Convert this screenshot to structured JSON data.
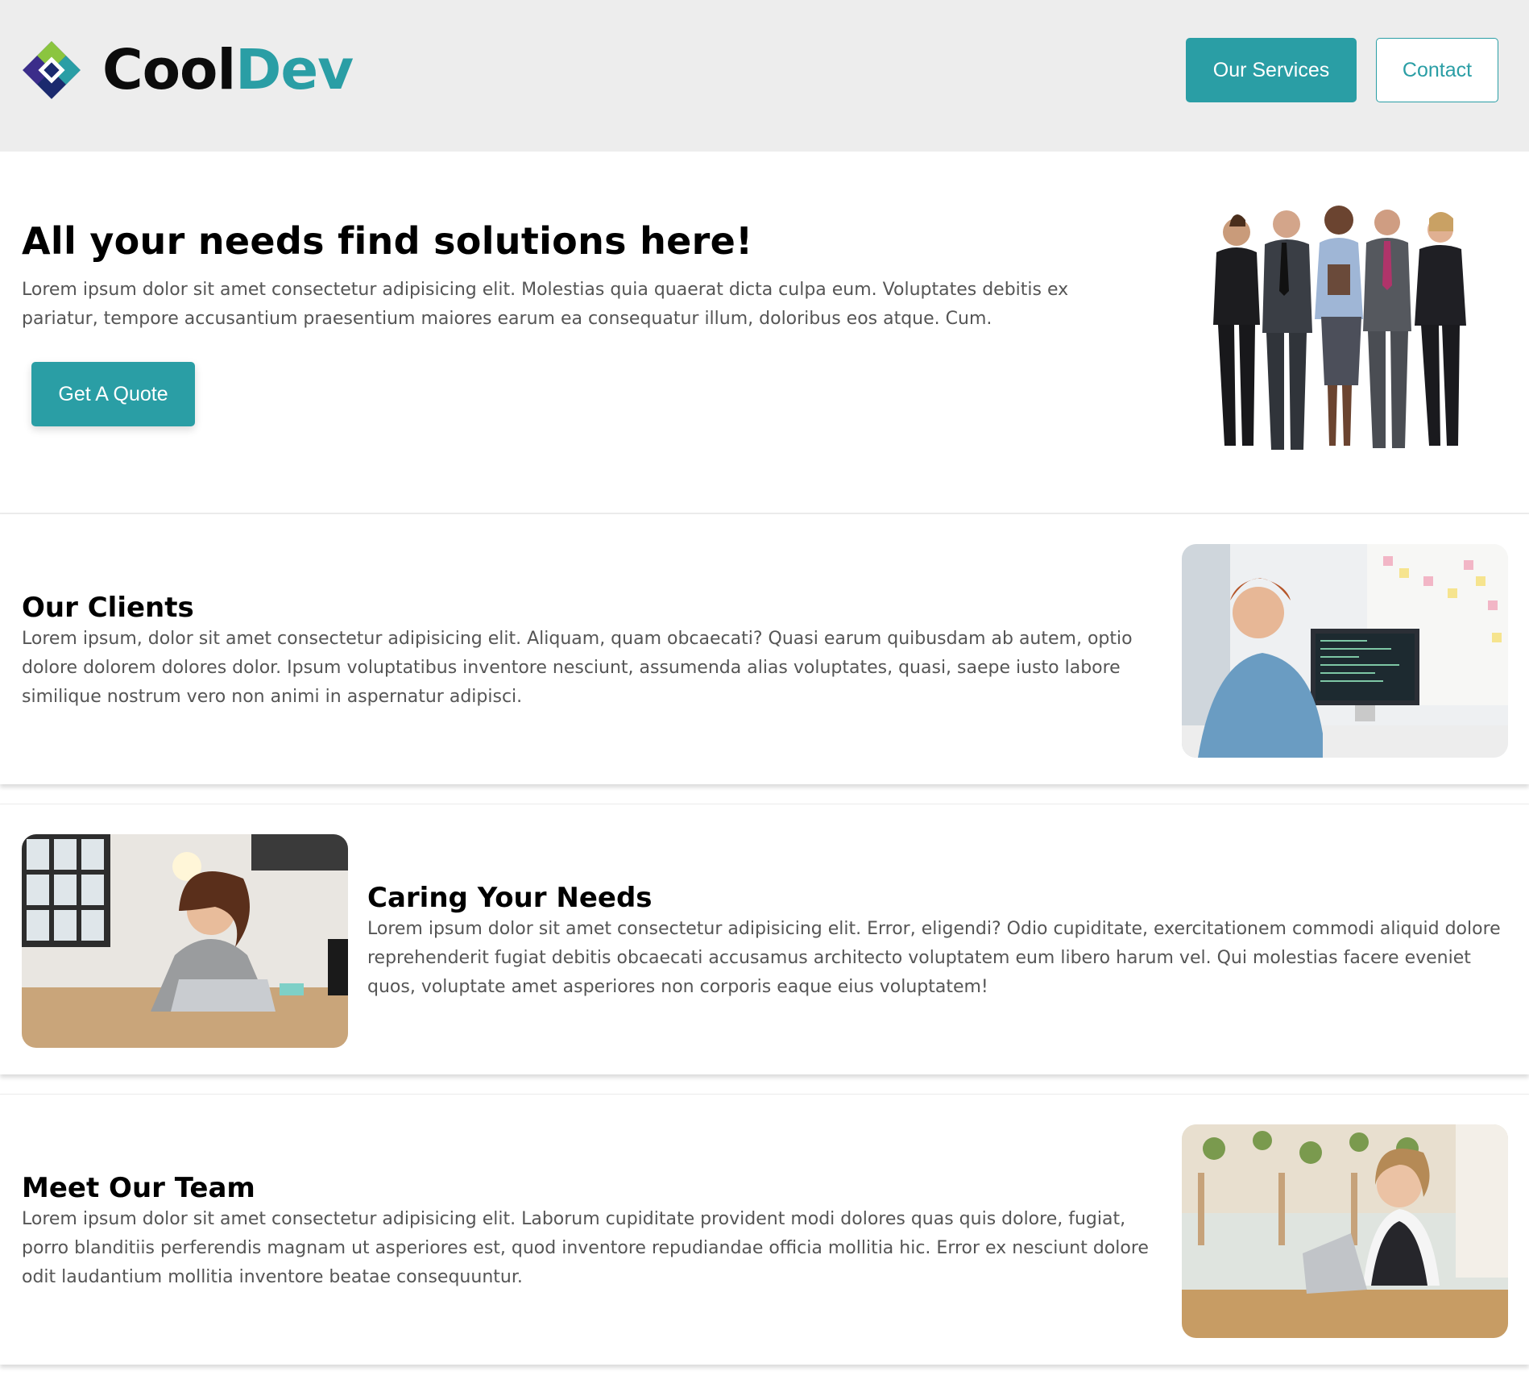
{
  "header": {
    "logo_cool": "Cool",
    "logo_dev": "Dev",
    "nav": {
      "services_label": "Our Services",
      "contact_label": "Contact"
    }
  },
  "hero": {
    "title": "All your needs find solutions here!",
    "body": "Lorem ipsum dolor sit amet consectetur adipisicing elit. Molestias quia quaerat dicta culpa eum. Voluptates debitis ex pariatur, tempore accusantium praesentium maiores earum ea consequatur illum, doloribus eos atque. Cum.",
    "cta_label": "Get A Quote"
  },
  "sections": [
    {
      "title": "Our Clients",
      "body": "Lorem ipsum, dolor sit amet consectetur adipisicing elit. Aliquam, quam obcaecati? Quasi earum quibusdam ab autem, optio dolore dolorem dolores dolor. Ipsum voluptatibus inventore nesciunt, assumenda alias voluptates, quasi, saepe iusto labore similique nostrum vero non animi in aspernatur adipisci."
    },
    {
      "title": "Caring Your Needs",
      "body": "Lorem ipsum dolor sit amet consectetur adipisicing elit. Error, eligendi? Odio cupiditate, exercitationem commodi aliquid dolore reprehenderit fugiat debitis obcaecati accusamus architecto voluptatem eum libero harum vel. Qui molestias facere eveniet quos, voluptate amet asperiores non corporis eaque eius voluptatem!"
    },
    {
      "title": "Meet Our Team",
      "body": "Lorem ipsum dolor sit amet consectetur adipisicing elit. Laborum cupiditate provident modi dolores quas quis dolore, fugiat, porro blanditiis perferendis magnam ut asperiores est, quod inventore repudiandae officia mollitia hic. Error ex nesciunt dolore odit laudantium mollitia inventore beatae consequuntur."
    }
  ],
  "colors": {
    "accent": "#2a9ea5",
    "header_bg": "#ededed",
    "body_text": "#555555"
  },
  "icons": {
    "logo": "cooldev-diamond-logo"
  }
}
